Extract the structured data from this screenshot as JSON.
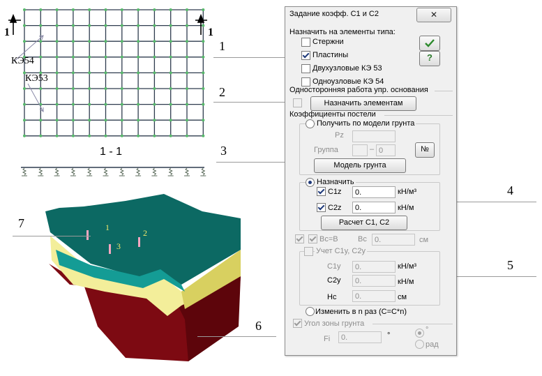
{
  "illustration": {
    "section_mark_left": "1",
    "section_mark_right": "1",
    "element_label_1": "КЭ54",
    "element_label_2": "КЭ53",
    "section_title": "1 - 1",
    "model_labels": [
      "1",
      "2",
      "3"
    ]
  },
  "callouts": [
    "1",
    "2",
    "3",
    "4",
    "5",
    "6",
    "7"
  ],
  "dialog": {
    "title": "Задание коэфф. С1 и С2",
    "close_glyph": "✕",
    "assign_header": "Назначить на элементы типа:",
    "type_items": [
      {
        "label": "Стержни",
        "checked": false
      },
      {
        "label": "Пластины",
        "checked": true
      },
      {
        "label": "Двухузловые КЭ 53",
        "checked": false
      },
      {
        "label": "Одноузловые КЭ 54",
        "checked": false
      }
    ],
    "ok_icon": "checkmark-icon",
    "help_glyph": "?",
    "one_side_header": "Односторонняя работа упр. основания",
    "assign_elements_button": "Назначить элементам",
    "bed_coeff_header": "Коэффициенты постели",
    "soil_model": {
      "radio_label": "Получить по модели грунта",
      "pz_label": "Pz",
      "group_label": "Группа",
      "group_dash": "–",
      "group_to_value": "0",
      "number_button": "№",
      "soil_model_button": "Модель грунта"
    },
    "assign": {
      "radio_label": "Назначить",
      "c1z_label": "C1z",
      "c1z_value": "0.",
      "c1z_unit": "кН/м³",
      "c2z_label": "C2z",
      "c2z_value": "0.",
      "c2z_unit": "кН/м",
      "calc_button": "Расчет С1, С2"
    },
    "bc_eq_b_label": "Bc=B",
    "bc_label": "Bc",
    "bc_value": "0.",
    "bc_unit": "см",
    "c1y": {
      "group_label": "Учет С1y, С2y",
      "c1y_label": "C1y",
      "c1y_value": "0.",
      "c1y_unit": "кН/м³",
      "c2y_label": "C2y",
      "c2y_value": "0.",
      "c2y_unit": "кН/м",
      "hc_label": "Нс",
      "hc_value": "0.",
      "hc_unit": "см"
    },
    "change_label": "Изменить в  n  раз (C=C*n)",
    "soil_angle_label": "Угол зоны грунта",
    "fi_label": "Fi",
    "fi_value": "0.",
    "fi_unit": "°",
    "unit_degree": "°",
    "unit_radian": "рад"
  }
}
